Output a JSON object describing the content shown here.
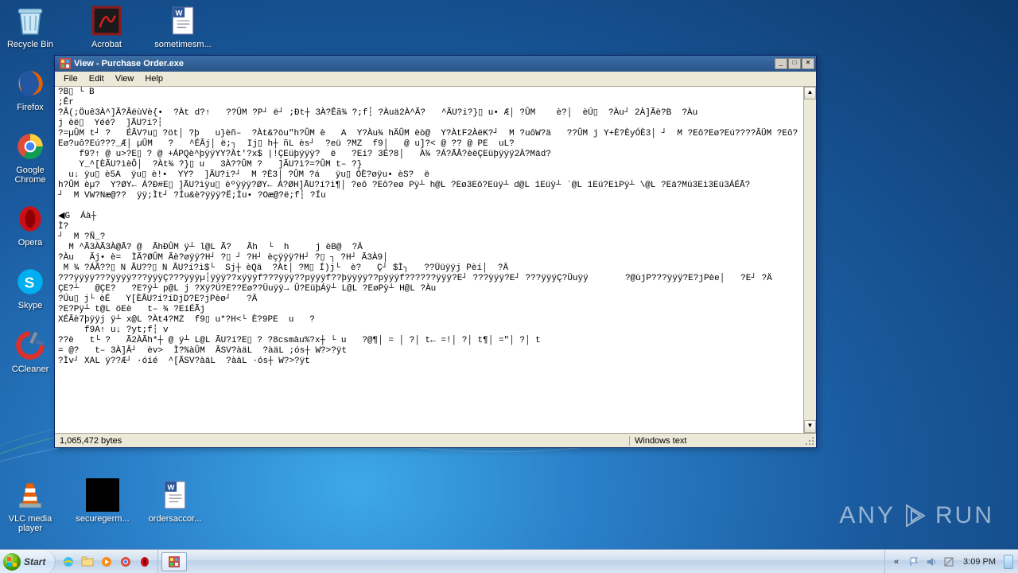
{
  "desktop": {
    "row1": {
      "recycle": "Recycle Bin",
      "acrobat": "Acrobat",
      "doc1": "sometimesm..."
    },
    "col": {
      "firefox": "Firefox",
      "chrome": "Google Chrome",
      "opera": "Opera",
      "skype": "Skype",
      "ccleaner": "CCleaner"
    },
    "row2": {
      "vlc": "VLC media player",
      "secure": "securegerm...",
      "orders": "ordersaccor..."
    }
  },
  "window": {
    "title": "View - Purchase Order.exe",
    "menu": {
      "file": "File",
      "edit": "Edit",
      "view": "View",
      "help": "Help"
    },
    "content": "?B▯ └ B\n;Êr\n?Â(;Öuê3À^]Ã?ÂëùVè{•  ?Àt d?↑   ??ÛM ?P┘ ë┘ ;Ðt┼ 3À?Êã¾ ?;f┆ ?Àuä2À^Ã?   ^ÃU?i?}▯ u• Æ│ ?ÛM    è?│  èÚ▯  ?Àu┘ 2À]Ãè?B  ?Àu\nj èë▯  Yéé?  ]ÃU?i?┆\n?=µÛM t┘ ?   ÉÂV?u▯ ?öt│ ?þ   u}èñ–  ?Àt&?öu\"h?ÛM è   A  Y?Àu¾ hÄÛM èò@  Y?ÀtF2ÀëK?┘  M ?uôW?ä   ??ÛM j Y+È?ÈyÓÈ3│ ┘  M ?Eô?Eø?Eú????ÂÜM ?Eô?\nEø?uô?Eú???_Æ│ µÛM   ?   ^ÉÃj│ ë;┐  Ij▯ h┼ ñL ès┘  ?eü ?MZ  f9│   @ u]?< @ ?? @ PE  uL?\n    f9?↑ @ u>?E▯ ? @ +ÁPQè^þÿÿYY?Àt'?x$ |!ÇEüþÿÿÿ?  ë   ?Ei? 3É?8│   À¾ ?Á?ÃÂ?èëÇEüþÿÿÿ2À?Mäd?\n    Y_^[ÈÃU?ìèÔ│  ?Àt¾ ?}▯ u   3À??ÛM ?   ]ÃU?ì?=?ÛM t– ?}\n  u↓ ÿu▯ è5A  ÿu▯ è!•  YY?  ]ÃU?i?┘  M ?È3│ ?ÛM ?á   ÿu▯ ÓÈ?øÿu• èS?  ë\nh?ÛM èµ?  Y?ØY← Á?Ð#E▯ ]ÃU?ìÿu▯ èºÿÿÿ?ØY← Á?ØH]ÃU?í?ì¶│ ?eô ?Eô?eø Pÿ┴ h@L ?Eø3Eô?Eüÿ┴ d@L 1Eüÿ┴ `@L 1Eü?EìPÿ┴ \\@L ?Eä?Mü3Eì3Eü3ÁÉÃ?\n┘  M VW?Næ@??  ÿÿ;Ìt┘ ?Íu&è?ÿÿÿ?Ë;Ìu• ?Oæ@?ë;f┆ ?Íu\n\n◀G  Áà┼\nÌ?\n┘  M ?Ñ_?\n  M ^Ã3ÀÃ3À@Ã? @  ÃhÐÛM ÿ┴ l@L Ã?   Ãh  └  h     j èB@  ?Ä\n?Àu   Ãj• è=  ÌÃ?ØÛM Ãè?øÿÿ?H┘ ?▯ ┘ ?H┘ èçÿÿÿ?H┘ ?▯ ┐ ?H┘ Ã3À9│\n M ¾ ?ÁÃ??▯ N ÃU??▯ N ÃU?í?ì$└  Sj┼ èQä  ?Àt│ ?M▯ Í)j└  è?   Ç┘ $Ì┐   ??Üüÿÿj Pèí│  ?Ä\n???ÿÿÿÿ???ÿÿÿÿ???ÿÿÿÇ???ÿÿÿµ┆ÿÿÿ??xÿÿÿf???ÿÿÿ??pÿÿÿf??þÿÿÿÿ??pÿÿÿf??????ÿÿÿ?E┘ ???ÿÿÿ?E┘ ???ÿÿÿÇ?Üuÿÿ       ?@ùjP???ÿÿÿ?E?jPèe│   ?E┘ ?Ä\nÇE?┴   @ÇE?   ?E?ÿ┴ p@L j ?Xÿ?Ú?E??Eø??Üuÿÿ→ Û?EüþÁÿ┴ L@L ?EøPÿ┴ H@L ?Àu\n?Úu▯ j└ èÉ   Y[ÈÃU?í?íDjD?E?jPèø┘   ?Ä\n?E?Pÿ┴ t@L öEè   t– ¾ ?EíÉÃj\nXÉÃè7þÿÿj ÿ┴ x@L ?Àt4?MZ  f9▯ u*?H<└ È?9PE  u   ?\n     f9A↑ u↓ ?yt;f┆ v\n??è   t└ ?   Ã2ÀÃh*┼ @ ÿ┴ L@L ÃU?í?E▯ ? ?8csmàu%?x┼ └ u   ?@¶│ = │ ?│ t← =!│ ?│ t¶│ =\"│ ?│ t\n= @?   t– 3À]Â┘  èv>  Ì?%àÛM  ÃSV?àäL  ?àäL ;ós┼ W?>?ÿt\n?Ìv┘ XAL ÿ??Æ┘ ·óíé  ^[ÃSV?àäL  ?àäL ·ós┼ W?>?ÿt",
    "status_left": "1,065,472 bytes",
    "status_right": "Windows text"
  },
  "taskbar": {
    "start": "Start",
    "time": "3:09 PM"
  },
  "watermark": {
    "a": "ANY",
    "b": "RUN"
  }
}
